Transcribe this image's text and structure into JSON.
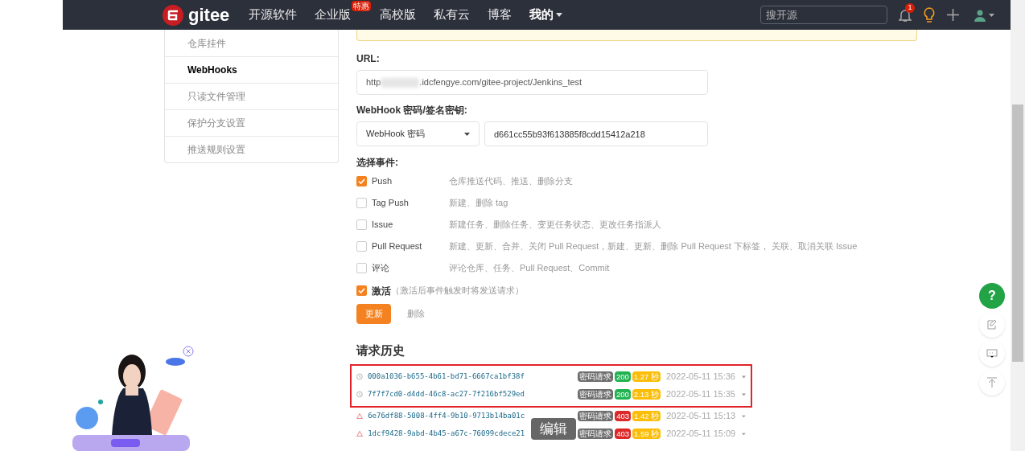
{
  "header": {
    "logo_text": "gitee",
    "nav": [
      {
        "label": "开源软件",
        "selected": false
      },
      {
        "label": "企业版",
        "selected": false,
        "badge": "特惠"
      },
      {
        "label": "高校版",
        "selected": false
      },
      {
        "label": "私有云",
        "selected": false
      },
      {
        "label": "博客",
        "selected": false
      },
      {
        "label": "我的",
        "selected": true,
        "dropdown": true
      }
    ],
    "search": {
      "placeholder": "搜开源"
    },
    "notification_count": "1"
  },
  "sidebar": {
    "items": [
      {
        "label": "仓库挂件",
        "selected": false
      },
      {
        "label": "WebHooks",
        "selected": true
      },
      {
        "label": "只读文件管理",
        "selected": false
      },
      {
        "label": "保护分支设置",
        "selected": false
      },
      {
        "label": "推送规则设置",
        "selected": false
      }
    ]
  },
  "form": {
    "url_label": "URL:",
    "url_value_start": "http",
    "url_value_end": ".idcfengye.com/gitee-project/Jenkins_test",
    "secret_label": "WebHook 密码/签名密钥:",
    "secret_type": "WebHook 密码",
    "secret_value": "d661cc55b93f613885f8cdd15412a218",
    "events_label": "选择事件:",
    "events": [
      {
        "name": "Push",
        "description": "仓库推送代码、推送、删除分支",
        "checked": true
      },
      {
        "name": "Tag Push",
        "description": "新建、删除 tag",
        "checked": false
      },
      {
        "name": "Issue",
        "description": "新建任务、删除任务、变更任务状态、更改任务指派人",
        "checked": false
      },
      {
        "name": "Pull Request",
        "description": "新建、更新、合并、关闭 Pull Request，新建、更新、删除 Pull Request 下标签， 关联、取消关联 Issue",
        "checked": false
      },
      {
        "name": "评论",
        "description": "评论仓库、任务、Pull Request、Commit",
        "checked": false
      }
    ],
    "activate": {
      "label": "激活",
      "hint": "（激活后事件触发时将发送请求）",
      "checked": true
    },
    "buttons": {
      "update": "更新",
      "delete": "删除"
    }
  },
  "history": {
    "title": "请求历史",
    "rows": [
      {
        "kind": "ok",
        "id": "000a1036-b655-4b61-bd71-6667ca1bf38f",
        "tag": "密码请求",
        "code": "200",
        "duration": "1.27 秒",
        "time": "2022-05-11 15:36",
        "highlighted": true
      },
      {
        "kind": "ok",
        "id": "7f7f7cd0-d4dd-46c8-ac27-7f216bf529ed",
        "tag": "密码请求",
        "code": "200",
        "duration": "2.13 秒",
        "time": "2022-05-11 15:35",
        "highlighted": true
      },
      {
        "kind": "error",
        "id": "6e76df88-5008-4ff4-9b10-9713b14ba01c",
        "tag": "密码请求",
        "code": "403",
        "duration": "1.42 秒",
        "time": "2022-05-11 15:13",
        "highlighted": false
      },
      {
        "kind": "error",
        "id": "1dcf9428-9abd-4b45-a67c-76099cdece21",
        "tag": "密码请求",
        "code": "403",
        "duration": "1.59 秒",
        "time": "2022-05-11 15:09",
        "highlighted": false
      }
    ]
  },
  "tooltip": "编辑",
  "help_button": "?"
}
